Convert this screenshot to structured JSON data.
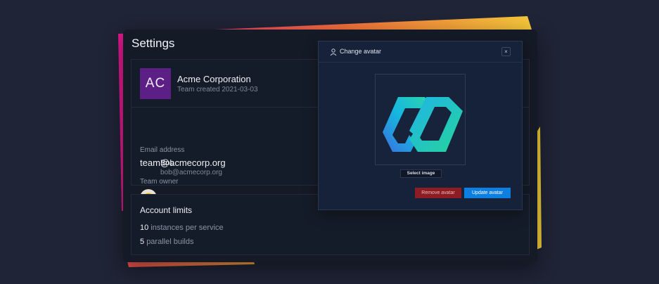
{
  "settings": {
    "title": "Settings"
  },
  "team": {
    "initials": "AC",
    "name": "Acme Corporation",
    "created": "Team created 2021-03-03",
    "email_label": "Email address",
    "email": "team@acmecorp.org",
    "owner_label": "Team owner",
    "owner_name": "Bob",
    "owner_email": "bob@acmecorp.org"
  },
  "limits": {
    "title": "Account limits",
    "instances_count": "10",
    "instances_text": "instances per service",
    "builds_count": "5",
    "builds_text": "parallel builds"
  },
  "modal": {
    "title": "Change avatar",
    "close_label": "×",
    "select_image": "Select image",
    "remove": "Remove avatar",
    "update": "Update avatar"
  },
  "colors": {
    "background": "#1f2436",
    "panel": "#141a26",
    "team_avatar": "#5b1f86",
    "remove_button": "#8c1d24",
    "update_button": "#0d7fe0",
    "accent_gradient": [
      "#e2188f",
      "#f8a13a",
      "#f5d23a"
    ]
  },
  "icons": {
    "modal_header": "user-icon",
    "close": "close-icon",
    "avatar_preview": "logo-n-icon"
  }
}
